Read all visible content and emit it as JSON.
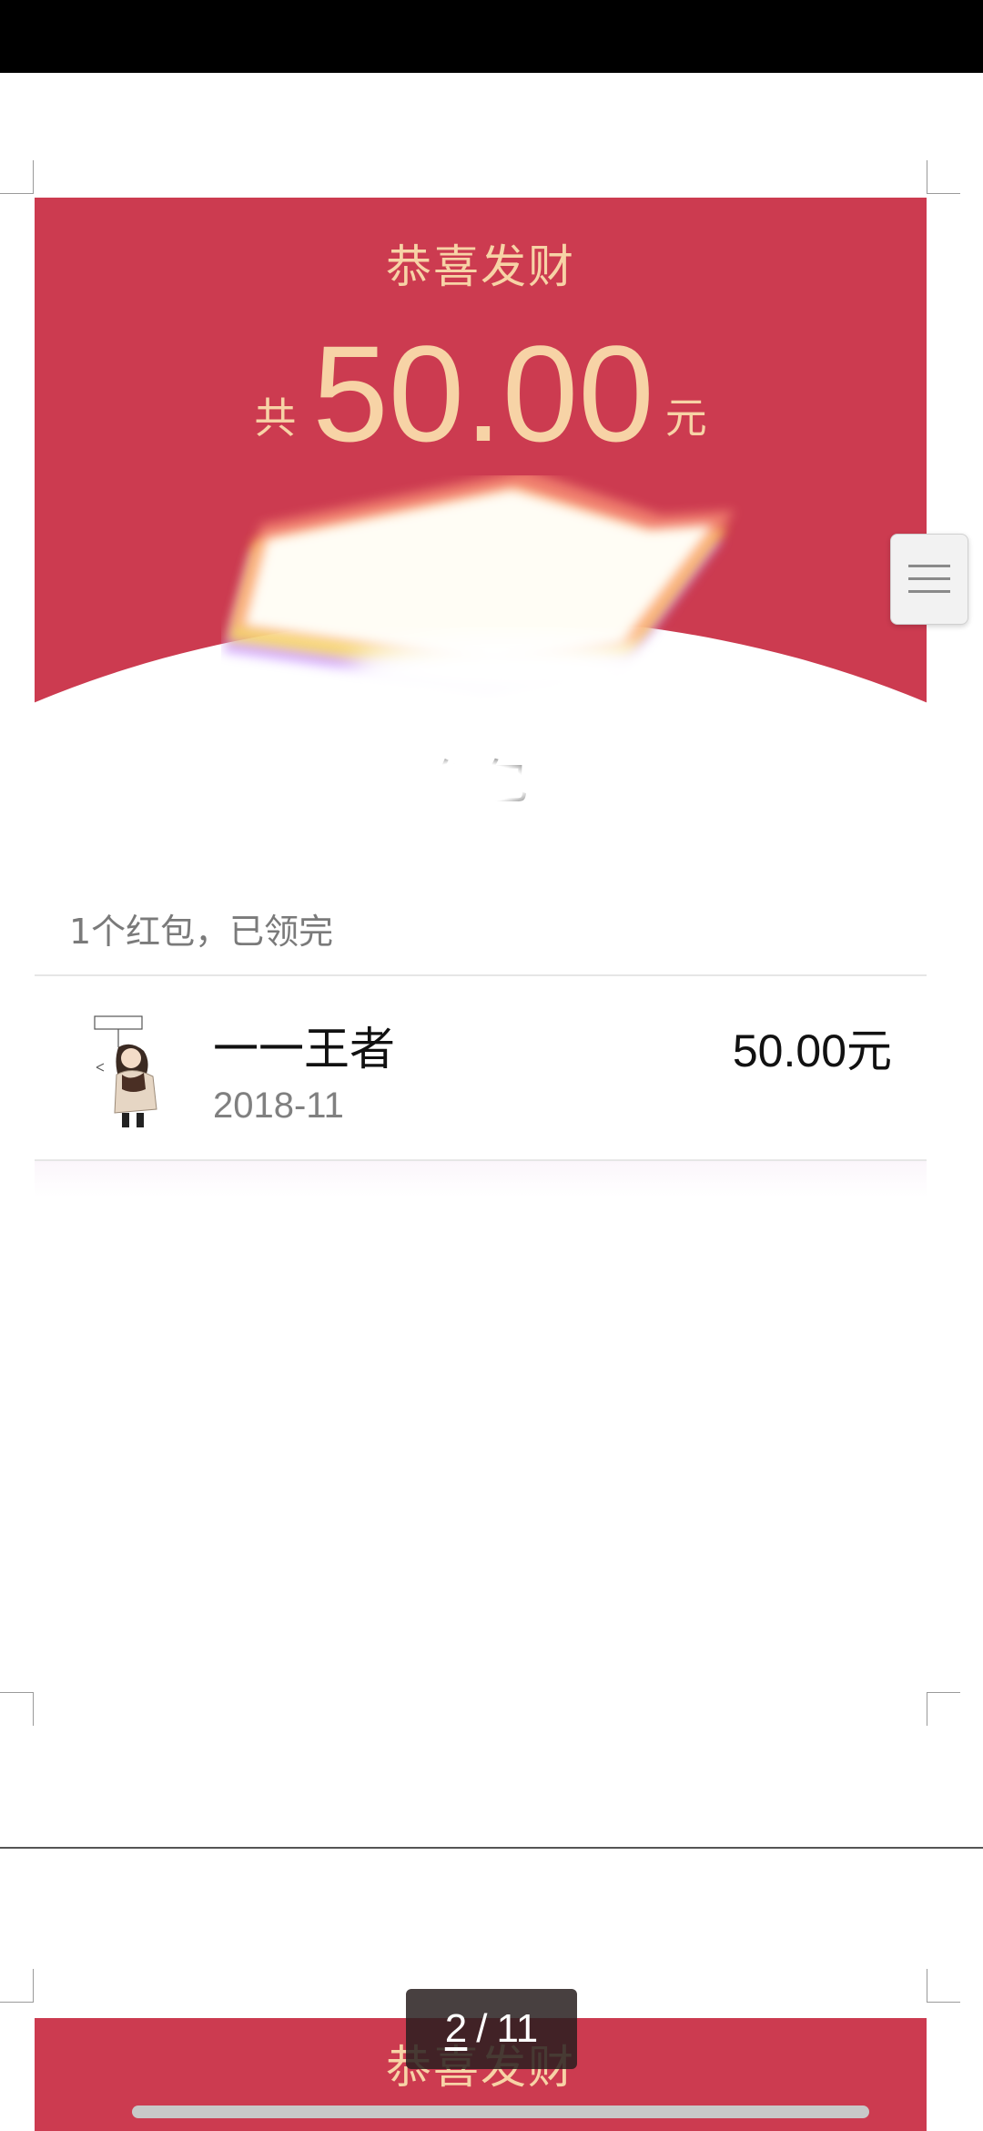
{
  "embedded_screenshot": {
    "header": {
      "greeting": "恭喜发财",
      "total_prefix": "共",
      "total_amount": "50.00",
      "total_unit": "元"
    },
    "redpack_title": "红包",
    "summary": "1个红包，已领完",
    "claims": [
      {
        "name": "一一王者",
        "amount": "50.00元",
        "time": "2018-11"
      }
    ]
  },
  "next_page": {
    "greeting": "恭喜发财"
  },
  "page_indicator": {
    "current": "2",
    "separator": "/",
    "total": "11"
  },
  "icons": {
    "menu": "hamburger-menu-icon",
    "avatar": "cartoon-avatar-icon"
  },
  "colors": {
    "header_red": "#cc3b50",
    "gold_text": "#f7d3a6",
    "muted_text": "#7a7a7a"
  }
}
